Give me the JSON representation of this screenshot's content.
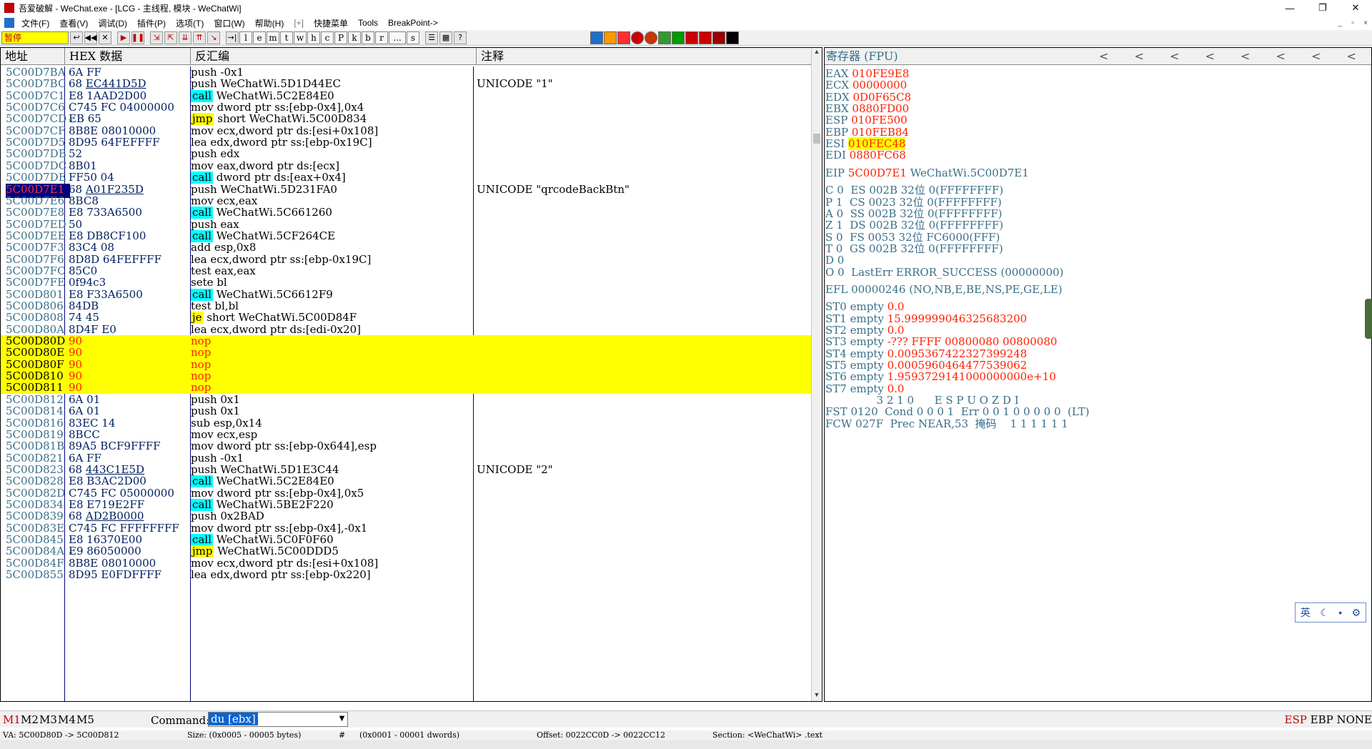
{
  "window": {
    "title": "吾爱破解 - WeChat.exe - [LCG - 主线程, 模块 - WeChatWi]",
    "minimize": "—",
    "restore": "❐",
    "close": "✕"
  },
  "menu": {
    "items": [
      "文件(F)",
      "查看(V)",
      "调试(D)",
      "插件(P)",
      "选项(T)",
      "窗口(W)",
      "帮助(H)",
      "[+]",
      "快捷菜单",
      "Tools",
      "BreakPoint->"
    ],
    "mdi_buttons": [
      "_",
      "▫",
      "×"
    ]
  },
  "toolbar": {
    "status": "暂停",
    "buttons": [
      "↩",
      "◀◀",
      "✕",
      "▶",
      "❚❚",
      "⇲",
      "⇱",
      "⇊",
      "⇈",
      "↘",
      "→|"
    ],
    "letters": [
      "l",
      "e",
      "m",
      "t",
      "w",
      "h",
      "c",
      "P",
      "k",
      "b",
      "r",
      "...",
      "s"
    ],
    "extra_icons": [
      "☰",
      "▦",
      "?"
    ],
    "color_icons": [
      "#1f6fc9",
      "#ff9900",
      "#ff3030",
      "#cc0000",
      "#cc3300",
      "#339933",
      "#009900",
      "#cc0000",
      "#cc0000",
      "#990000",
      "#000000"
    ]
  },
  "cpu": {
    "headers": [
      "地址",
      "HEX 数据",
      "反汇编",
      "注释"
    ],
    "rows": [
      {
        "addr": "5C00D7BA",
        "hex": "6A FF",
        "dis": "push -0x1",
        "cmt": ""
      },
      {
        "addr": "5C00D7BC",
        "hex": "68 EC441D5D",
        "dis": "push WeChatWi.5D1D44EC",
        "cmt": "UNICODE \"1\""
      },
      {
        "addr": "5C00D7C1",
        "hex": "E8 1AAD2D00",
        "tag": "call",
        "dis": "WeChatWi.5C2E84E0",
        "cmt": ""
      },
      {
        "addr": "5C00D7C6",
        "hex": "C745 FC 04000000",
        "dis": "mov dword ptr ss:[ebp-0x4],0x4",
        "cmt": ""
      },
      {
        "addr": "5C00D7CD",
        "hex": "EB 65",
        "tag": "jmp",
        "dis": "short WeChatWi.5C00D834",
        "cmt": "",
        "arrow": true
      },
      {
        "addr": "5C00D7CF",
        "hex": "8B8E 08010000",
        "dis": "mov ecx,dword ptr ds:[esi+0x108]",
        "cmt": ""
      },
      {
        "addr": "5C00D7D5",
        "hex": "8D95 64FEFFFF",
        "dis": "lea edx,dword ptr ss:[ebp-0x19C]",
        "cmt": ""
      },
      {
        "addr": "5C00D7DB",
        "hex": "52",
        "dis": "push edx",
        "cmt": ""
      },
      {
        "addr": "5C00D7DC",
        "hex": "8B01",
        "dis": "mov eax,dword ptr ds:[ecx]",
        "cmt": ""
      },
      {
        "addr": "5C00D7DE",
        "hex": "FF50 04",
        "tag": "call",
        "dis": "dword ptr ds:[eax+0x4]",
        "cmt": ""
      },
      {
        "addr": "5C00D7E1",
        "hex": "68 A01F235D",
        "dis": "push WeChatWi.5D231FA0",
        "cmt": "UNICODE \"qrcodeBackBtn\"",
        "current": true
      },
      {
        "addr": "5C00D7E6",
        "hex": "8BC8",
        "dis": "mov ecx,eax",
        "cmt": ""
      },
      {
        "addr": "5C00D7E8",
        "hex": "E8 733A6500",
        "tag": "call",
        "dis": "WeChatWi.5C661260",
        "cmt": ""
      },
      {
        "addr": "5C00D7ED",
        "hex": "50",
        "dis": "push eax",
        "cmt": ""
      },
      {
        "addr": "5C00D7EE",
        "hex": "E8 DB8CF100",
        "tag": "call",
        "dis": "WeChatWi.5CF264CE",
        "cmt": ""
      },
      {
        "addr": "5C00D7F3",
        "hex": "83C4 08",
        "dis": "add esp,0x8",
        "cmt": ""
      },
      {
        "addr": "5C00D7F6",
        "hex": "8D8D 64FEFFFF",
        "dis": "lea ecx,dword ptr ss:[ebp-0x19C]",
        "cmt": ""
      },
      {
        "addr": "5C00D7FC",
        "hex": "85C0",
        "dis": "test eax,eax",
        "cmt": ""
      },
      {
        "addr": "5C00D7FE",
        "hex": "0f94c3",
        "dis": "sete bl",
        "cmt": ""
      },
      {
        "addr": "5C00D801",
        "hex": "E8 F33A6500",
        "tag": "call",
        "dis": "WeChatWi.5C6612F9",
        "cmt": ""
      },
      {
        "addr": "5C00D806",
        "hex": "84DB",
        "dis": "test bl,bl",
        "cmt": ""
      },
      {
        "addr": "5C00D808",
        "hex": "74 45",
        "tag": "je",
        "dis": "short WeChatWi.5C00D84F",
        "cmt": "",
        "arrow": true
      },
      {
        "addr": "5C00D80A",
        "hex": "8D4F E0",
        "dis": "lea ecx,dword ptr ds:[edi-0x20]",
        "cmt": ""
      },
      {
        "addr": "5C00D80D",
        "hex": "90",
        "dis": "nop",
        "cmt": "",
        "hl": true
      },
      {
        "addr": "5C00D80E",
        "hex": "90",
        "dis": "nop",
        "cmt": "",
        "hl": true
      },
      {
        "addr": "5C00D80F",
        "hex": "90",
        "dis": "nop",
        "cmt": "",
        "hl": true
      },
      {
        "addr": "5C00D810",
        "hex": "90",
        "dis": "nop",
        "cmt": "",
        "hl": true
      },
      {
        "addr": "5C00D811",
        "hex": "90",
        "dis": "nop",
        "cmt": "",
        "hl": true
      },
      {
        "addr": "5C00D812",
        "hex": "6A 01",
        "dis": "push 0x1",
        "cmt": ""
      },
      {
        "addr": "5C00D814",
        "hex": "6A 01",
        "dis": "push 0x1",
        "cmt": ""
      },
      {
        "addr": "5C00D816",
        "hex": "83EC 14",
        "dis": "sub esp,0x14",
        "cmt": ""
      },
      {
        "addr": "5C00D819",
        "hex": "8BCC",
        "dis": "mov ecx,esp",
        "cmt": ""
      },
      {
        "addr": "5C00D81B",
        "hex": "89A5 BCF9FFFF",
        "dis": "mov dword ptr ss:[ebp-0x644],esp",
        "cmt": ""
      },
      {
        "addr": "5C00D821",
        "hex": "6A FF",
        "dis": "push -0x1",
        "cmt": ""
      },
      {
        "addr": "5C00D823",
        "hex": "68 443C1E5D",
        "dis": "push WeChatWi.5D1E3C44",
        "cmt": "UNICODE \"2\""
      },
      {
        "addr": "5C00D828",
        "hex": "E8 B3AC2D00",
        "tag": "call",
        "dis": "WeChatWi.5C2E84E0",
        "cmt": ""
      },
      {
        "addr": "5C00D82D",
        "hex": "C745 FC 05000000",
        "dis": "mov dword ptr ss:[ebp-0x4],0x5",
        "cmt": ""
      },
      {
        "addr": "5C00D834",
        "hex": "E8 E719E2FF",
        "tag": "call",
        "dis": "WeChatWi.5BE2F220",
        "cmt": ""
      },
      {
        "addr": "5C00D839",
        "hex": "68 AD2B0000",
        "dis": "push 0x2BAD",
        "cmt": ""
      },
      {
        "addr": "5C00D83E",
        "hex": "C745 FC FFFFFFFF",
        "dis": "mov dword ptr ss:[ebp-0x4],-0x1",
        "cmt": ""
      },
      {
        "addr": "5C00D845",
        "hex": "E8 16370E00",
        "tag": "call",
        "dis": "WeChatWi.5C0F0F60",
        "cmt": ""
      },
      {
        "addr": "5C00D84A",
        "hex": "E9 86050000",
        "tag": "jmp",
        "dis": "WeChatWi.5C00DDD5",
        "cmt": "",
        "arrow": true
      },
      {
        "addr": "5C00D84F",
        "hex": "8B8E 08010000",
        "dis": "mov ecx,dword ptr ds:[esi+0x108]",
        "cmt": ""
      },
      {
        "addr": "5C00D855",
        "hex": "8D95 E0FDFFFF",
        "dis": "lea edx,dword ptr ss:[ebp-0x220]",
        "cmt": ""
      }
    ]
  },
  "registers": {
    "header": "寄存器 (FPU)",
    "nav": [
      "<",
      "<",
      "<",
      "<",
      "<",
      "<",
      "<",
      "<"
    ],
    "lines": [
      {
        "k": "EAX ",
        "v": "010FE9E8"
      },
      {
        "k": "ECX ",
        "v": "00000000"
      },
      {
        "k": "EDX ",
        "v": "0D0F65C8"
      },
      {
        "k": "EBX ",
        "v": "0880FD00"
      },
      {
        "k": "ESP ",
        "v": "010FE500"
      },
      {
        "k": "EBP ",
        "v": "010FEB84"
      },
      {
        "k": "ESI ",
        "v": "010FEC48",
        "hl": true
      },
      {
        "k": "EDI ",
        "v": "0880FC68"
      },
      {
        "gap": true
      },
      {
        "k": "EIP ",
        "v": "5C00D7E1",
        "rest": " WeChatWi.5C00D7E1"
      },
      {
        "gap": true
      },
      {
        "k": "C 0  ES 002B 32位 0(FFFFFFFF)"
      },
      {
        "k": "P 1  CS 0023 32位 0(FFFFFFFF)"
      },
      {
        "k": "A 0  SS 002B 32位 0(FFFFFFFF)"
      },
      {
        "k": "Z 1  DS 002B 32位 0(FFFFFFFF)"
      },
      {
        "k": "S 0  FS 0053 32位 FC6000(FFF)"
      },
      {
        "k": "T 0  GS 002B 32位 0(FFFFFFFF)"
      },
      {
        "k": "D 0"
      },
      {
        "k": "O 0  LastErr ERROR_SUCCESS (00000000)"
      },
      {
        "gap": true
      },
      {
        "k": "EFL 00000246 (NO,NB,E,BE,NS,PE,GE,LE)"
      },
      {
        "gap": true
      },
      {
        "k": "ST0 empty ",
        "v": "0.0"
      },
      {
        "k": "ST1 empty ",
        "v": "15.999999046325683200"
      },
      {
        "k": "ST2 empty ",
        "v": "0.0"
      },
      {
        "k": "ST3 empty ",
        "v": "-??? FFFF 00800080 00800080"
      },
      {
        "k": "ST4 empty ",
        "v": "0.0095367422327399248"
      },
      {
        "k": "ST5 empty ",
        "v": "0.0005960464477539062"
      },
      {
        "k": "ST6 empty ",
        "v": "1.9593729141000000000e+10"
      },
      {
        "k": "ST7 empty ",
        "v": "0.0"
      },
      {
        "k": "               3 2 1 0      E S P U O Z D I"
      },
      {
        "k": "FST 0120  Cond 0 0 0 1  Err 0 0 1 0 0 0 0 0  (LT)"
      },
      {
        "k": "FCW 027F  Prec NEAR,53  掩码    1 1 1 1 1 1"
      }
    ]
  },
  "ime": {
    "lang": "英",
    "moon": "☾",
    "dot": "•",
    "gear": "⚙"
  },
  "cmdbar": {
    "markers": [
      "M1",
      "M2",
      "M3",
      "M4",
      "M5"
    ],
    "label": "Command:",
    "value": "du [ebx]",
    "right_esp": "ESP",
    "right_ebp": "EBP",
    "right_none": "NONE"
  },
  "status": {
    "va": "VA: 5C00D80D -> 5C00D812",
    "size": "Size: (0x0005 - 00005 bytes)",
    "hash": "#",
    "dwords": "(0x0001 - 00001 dwords)",
    "offset": "Offset: 0022CC0D -> 0022CC12",
    "section": "Section: <WeChatWi> .text"
  }
}
